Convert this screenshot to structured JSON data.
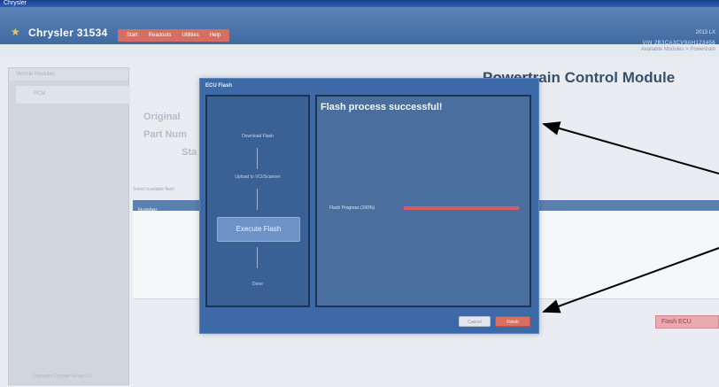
{
  "window": {
    "title": "Chrysler",
    "brand": "Chrysler 31534",
    "menu": [
      "Start",
      "Readouts",
      "Utilities",
      "Help"
    ],
    "header_right_1": "2013 LX",
    "header_right_2": "VIN 2B3CA3CV9AH123456"
  },
  "subbar": {
    "breadcrumb": "Available Modules > Powertrain"
  },
  "sidebar": {
    "heading": "Vehicle Modules",
    "item": "PCM",
    "footer": "Copyright Chrysler Group LLC"
  },
  "main": {
    "page_title": "Powertrain Control Module",
    "field_labels": [
      "Original",
      "Part Num",
      "Sta"
    ],
    "section_caption": "Select available flash",
    "grid_header": "Number",
    "flash_button": "Flash ECU"
  },
  "dialog": {
    "title": "ECU Flash",
    "steps": [
      "Download Flash",
      "Upload to VCI/Scanner",
      "Execute Flash",
      "Done"
    ],
    "active_step": "Execute Flash",
    "status": "Flash process successful!",
    "progress_label": "Flash Progress (100%)",
    "progress_value": 1.0,
    "cancel_label": "Cancel",
    "finish_label": "Finish"
  },
  "colors": {
    "accent": "#3d6aa6",
    "progress": "#d85a64",
    "finish": "#d86f62"
  },
  "icons": {
    "logo": "star-icon"
  }
}
